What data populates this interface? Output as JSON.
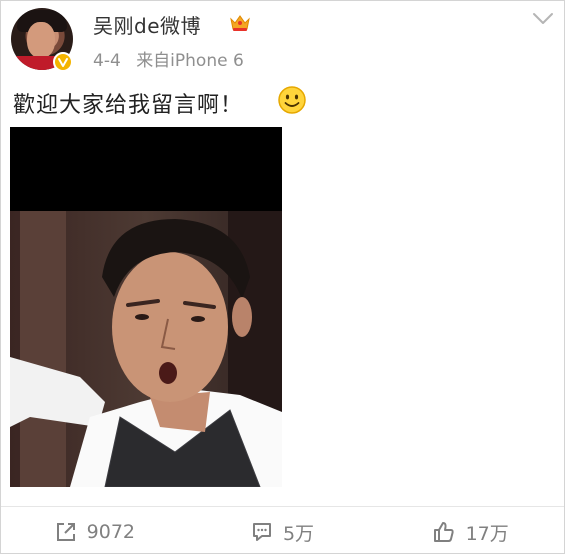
{
  "post": {
    "username": "吴刚de微博",
    "date": "4-4",
    "source": "来自iPhone 6",
    "text": "歡迎大家给我留言啊！"
  },
  "actions": {
    "repost_count": "9072",
    "comment_count": "5万",
    "like_count": "17万"
  },
  "icons": {
    "verified": "verified-badge-icon",
    "member": "crown-icon",
    "emoji": "smiley-icon",
    "menu": "chevron-down-icon",
    "repost": "repost-icon",
    "comment": "comment-icon",
    "like": "thumbs-up-icon"
  },
  "colors": {
    "verified_badge": "#f4b400",
    "crown": "#f5a623",
    "action_text": "#808080",
    "meta_text": "#8f8f8f"
  }
}
